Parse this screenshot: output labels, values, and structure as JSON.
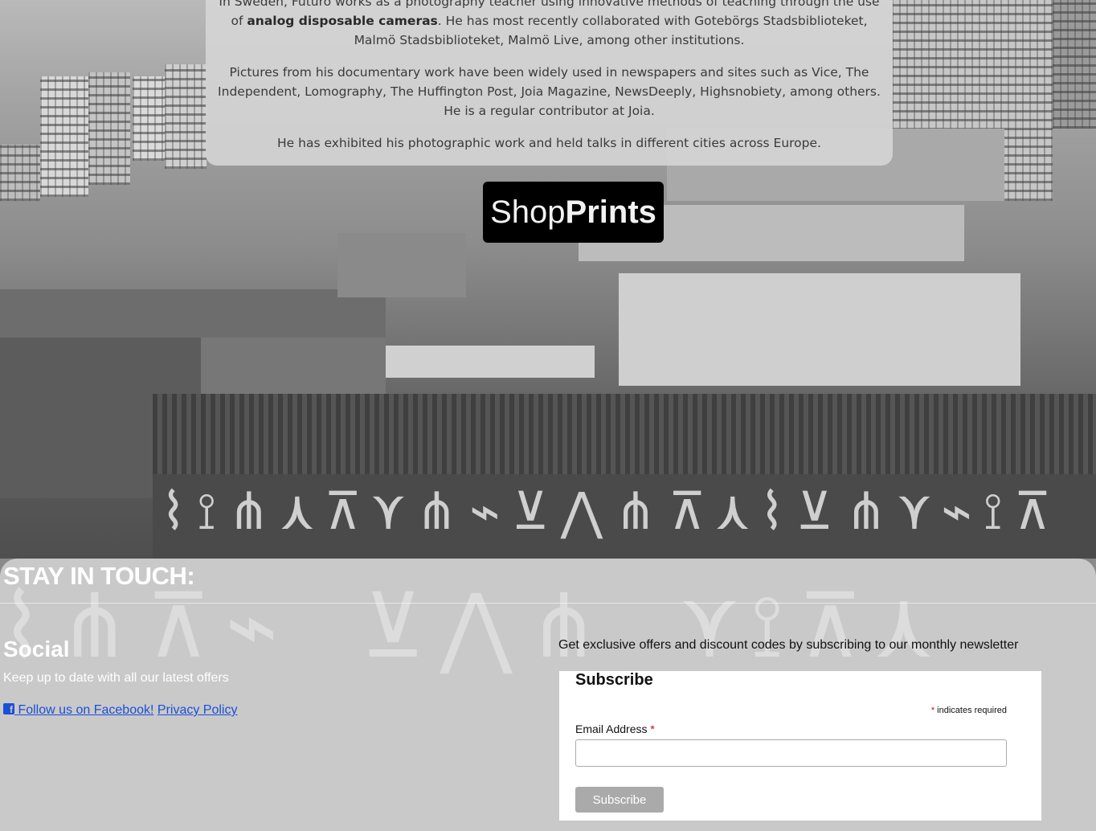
{
  "bio": {
    "para1_pre": "In Sweden, Futuro works as a photography teacher using innovative methods of teaching through the use of ",
    "para1_bold": "analog disposable cameras",
    "para1_post": ". He has most recently collaborated with Gotebörgs Stadsbiblioteket, Malmö Stadsbiblioteket, Malmö Live, among other institutions.",
    "para2": "Pictures from his documentary work have been widely used in newspapers and sites such as Vice, The Independent, Lomography, The Huffington Post, Joia Magazine, NewsDeeply, Highsnobiety, among others. He is a regular contributor at Joia.",
    "para3": "He has exhibited his photographic work and held talks in different cities across Europe."
  },
  "shop_button": {
    "light": "Shop",
    "bold": "Prints"
  },
  "footer": {
    "title": "STAY IN TOUCH:",
    "social": {
      "heading": "Social",
      "text": "Keep up to date with all our latest offers",
      "facebook_link": "Follow us on Facebook!",
      "privacy_link": "Privacy Policy",
      "facebook_icon": "facebook-square-icon"
    },
    "newsletter": {
      "intro": "Get exclusive offers and discount codes by subscribing to our monthly newsletter",
      "form_title": "Subscribe",
      "required_note": "indicates required",
      "email_label": "Email Address",
      "email_value": "",
      "submit_label": "Subscribe"
    }
  },
  "colors": {
    "link": "#1a4fd8",
    "required_asterisk": "#d0021b",
    "shop_button_bg": "#000000",
    "submit_button_bg": "#aaaaaa"
  }
}
